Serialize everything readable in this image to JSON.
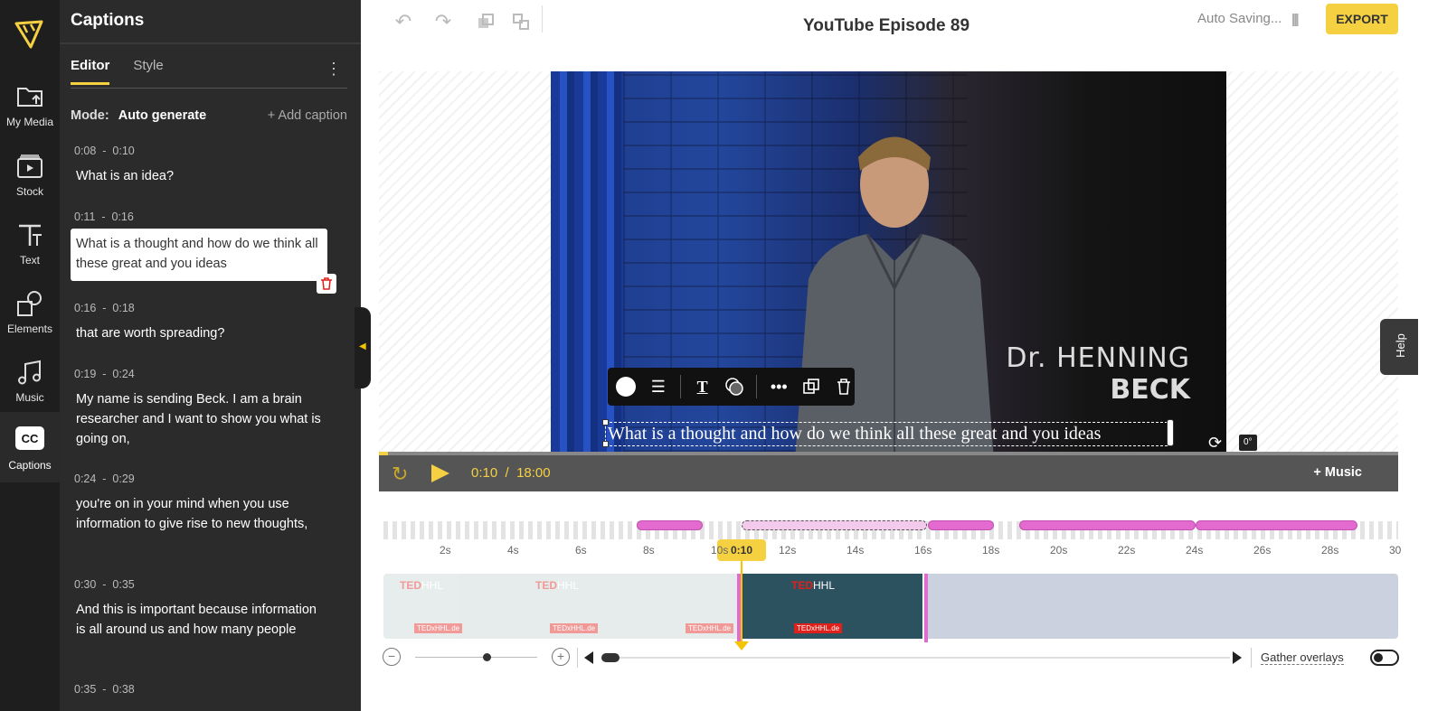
{
  "rail": {
    "items": [
      {
        "label": "My Media",
        "icon": "folder-upload-icon"
      },
      {
        "label": "Stock",
        "icon": "film-stock-icon"
      },
      {
        "label": "Text",
        "icon": "text-icon"
      },
      {
        "label": "Elements",
        "icon": "shapes-icon"
      },
      {
        "label": "Music",
        "icon": "music-note-icon"
      },
      {
        "label": "Captions",
        "icon": "cc-icon",
        "active": true,
        "cc_text": "CC"
      }
    ]
  },
  "panel": {
    "title": "Captions",
    "tabs": [
      {
        "label": "Editor",
        "active": true
      },
      {
        "label": "Style",
        "active": false
      }
    ],
    "mode_label": "Mode:",
    "mode_value": "Auto generate",
    "add_caption": "+ Add caption",
    "captions": [
      {
        "start": "0:08",
        "sep": "-",
        "end": "0:10",
        "text": "What is an idea?"
      },
      {
        "start": "0:11",
        "sep": "-",
        "end": "0:16",
        "text": "What is a thought and how do we think all these great and you ideas",
        "active": true
      },
      {
        "start": "0:16",
        "sep": "-",
        "end": "0:18",
        "text": "that are worth spreading?"
      },
      {
        "start": "0:19",
        "sep": "-",
        "end": "0:24",
        "text": "My name is sending Beck. I am a brain researcher and I want to show you what is going on,"
      },
      {
        "start": "0:24",
        "sep": "-",
        "end": "0:29",
        "text": "you're on in your mind when you use information to give rise to new thoughts,"
      },
      {
        "start": "0:30",
        "sep": "-",
        "end": "0:35",
        "text": "And this is important because information is all around us and how many people"
      },
      {
        "start": "0:35",
        "sep": "-",
        "end": "0:38",
        "text": ""
      }
    ]
  },
  "header": {
    "title": "YouTube Episode 89",
    "autosave": "Auto Saving...",
    "export_label": "EXPORT"
  },
  "video": {
    "lower_third_line1": "Dr. HENNING",
    "lower_third_line2": "BECK",
    "caption_overlay": "What is a thought and how do we think all these great and you ideas",
    "rotation": "0°"
  },
  "player": {
    "current_time": "0:10",
    "separator": "/",
    "total_time": "18:00",
    "progress": 0.009,
    "music_label": "+ Music"
  },
  "timeline": {
    "playhead_label": "0:10",
    "ruler": [
      "2s",
      "4s",
      "6s",
      "8s",
      "10s",
      "12s",
      "14s",
      "16s",
      "18s",
      "20s",
      "22s",
      "24s",
      "26s",
      "28s",
      "30"
    ],
    "ted_logo": "TED",
    "ted_logo_suffix": "HHL",
    "ted_small": "TEDxHHL.de",
    "gather_overlays": "Gather overlays"
  },
  "help": {
    "label": "Help"
  },
  "colors": {
    "accent": "#f5d142",
    "caption_clip": "#e36bd0",
    "panel_bg": "#2b2b2b",
    "rail_bg": "#1e1e1e"
  }
}
